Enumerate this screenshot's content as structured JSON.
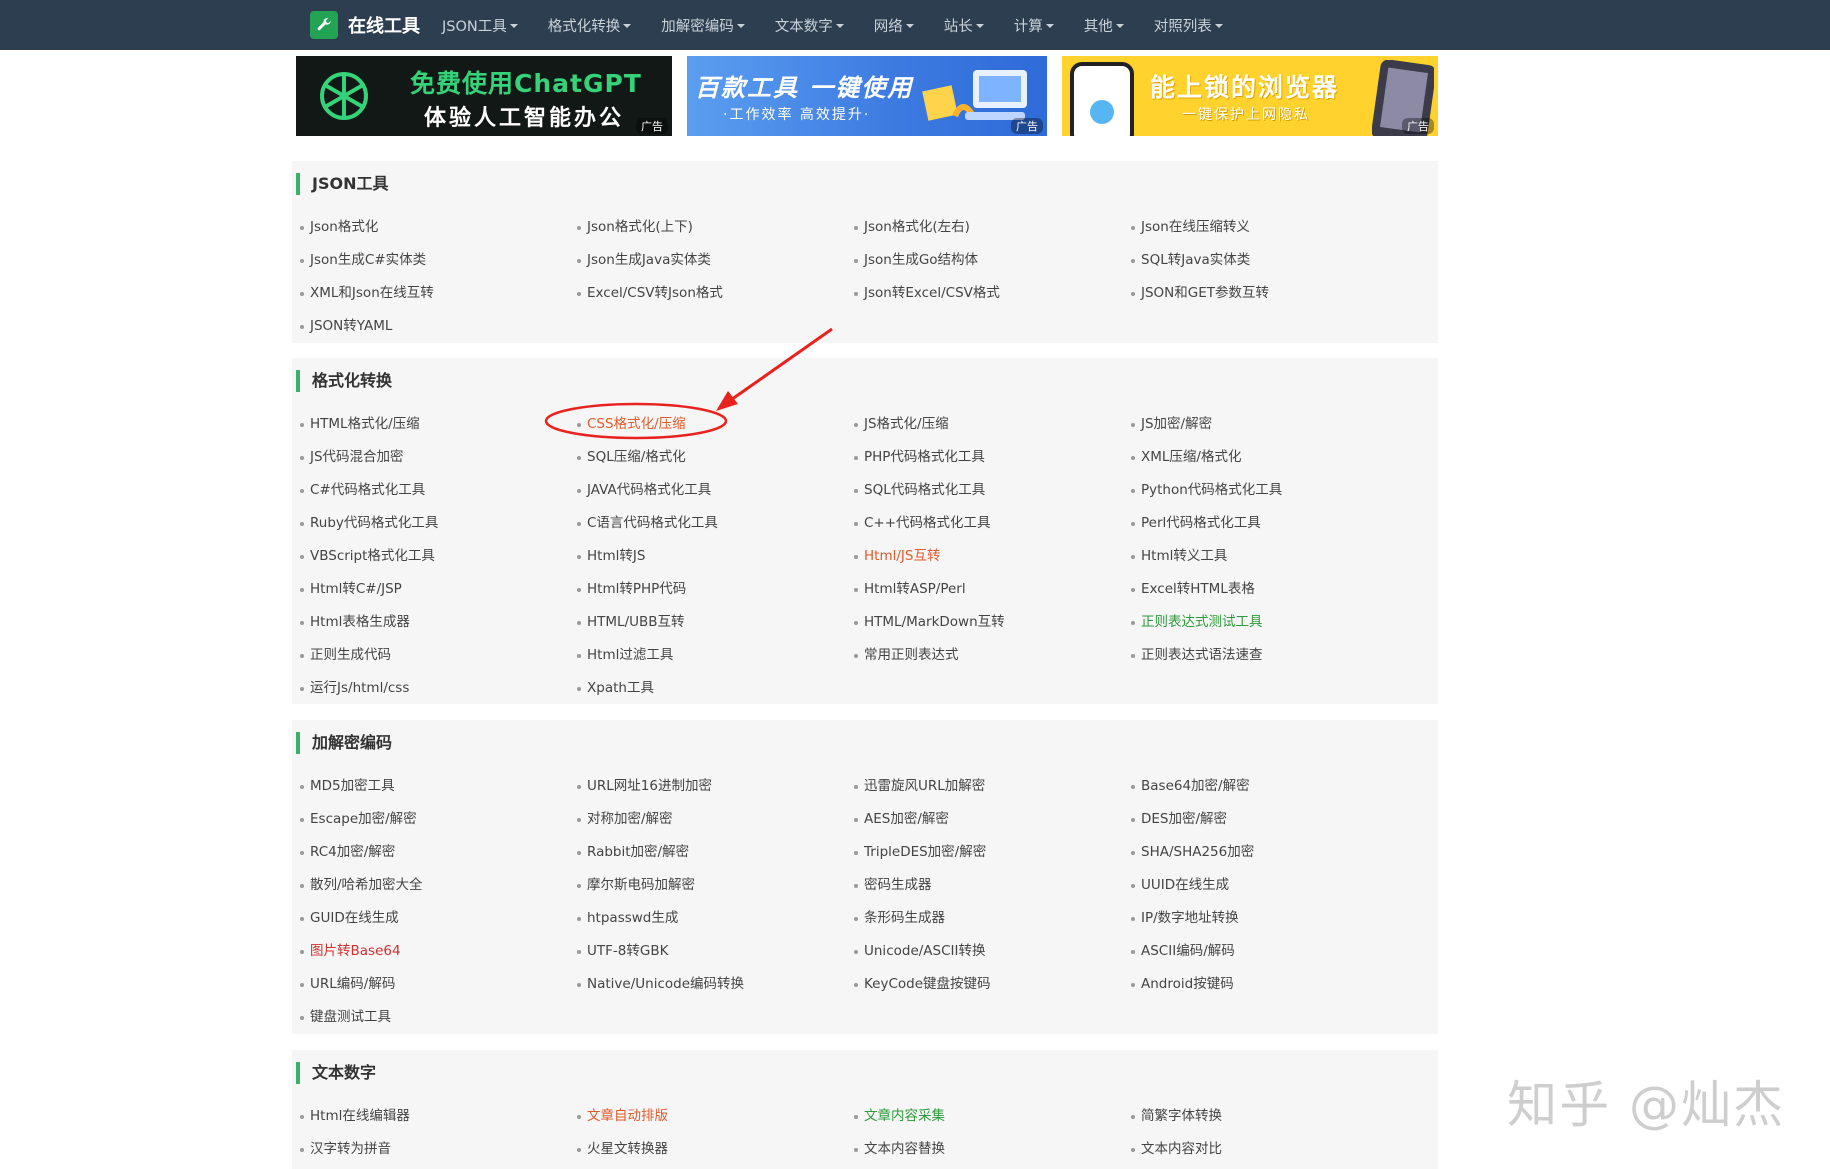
{
  "nav": {
    "brand": "在线工具",
    "items": [
      "JSON工具",
      "格式化转换",
      "加解密编码",
      "文本数字",
      "网络",
      "站长",
      "计算",
      "其他",
      "对照列表"
    ]
  },
  "banners": [
    {
      "line1": "免费使用ChatGPT",
      "line2": "体验人工智能办公",
      "tag": "广告"
    },
    {
      "line1": "百款工具 一键使用",
      "line2": "·工作效率 高效提升·",
      "tag": "广告"
    },
    {
      "line1": "能上锁的浏览器",
      "line2": "一键保护上网隐私",
      "tag": "广告"
    }
  ],
  "sections": [
    {
      "title": "JSON工具",
      "items": [
        {
          "label": "Json格式化"
        },
        {
          "label": "Json格式化(上下)"
        },
        {
          "label": "Json格式化(左右)"
        },
        {
          "label": "Json在线压缩转义"
        },
        {
          "label": "Json生成C#实体类"
        },
        {
          "label": "Json生成Java实体类"
        },
        {
          "label": "Json生成Go结构体"
        },
        {
          "label": "SQL转Java实体类"
        },
        {
          "label": "XML和Json在线互转"
        },
        {
          "label": "Excel/CSV转Json格式"
        },
        {
          "label": "Json转Excel/CSV格式"
        },
        {
          "label": "JSON和GET参数互转"
        },
        {
          "label": "JSON转YAML"
        }
      ]
    },
    {
      "title": "格式化转换",
      "items": [
        {
          "label": "HTML格式化/压缩"
        },
        {
          "label": "CSS格式化/压缩",
          "style": "red"
        },
        {
          "label": "JS格式化/压缩"
        },
        {
          "label": "JS加密/解密"
        },
        {
          "label": "JS代码混合加密"
        },
        {
          "label": "SQL压缩/格式化"
        },
        {
          "label": "PHP代码格式化工具"
        },
        {
          "label": "XML压缩/格式化"
        },
        {
          "label": "C#代码格式化工具"
        },
        {
          "label": "JAVA代码格式化工具"
        },
        {
          "label": "SQL代码格式化工具"
        },
        {
          "label": "Python代码格式化工具"
        },
        {
          "label": "Ruby代码格式化工具"
        },
        {
          "label": "C语言代码格式化工具"
        },
        {
          "label": "C++代码格式化工具"
        },
        {
          "label": "Perl代码格式化工具"
        },
        {
          "label": "VBScript格式化工具"
        },
        {
          "label": "Html转JS"
        },
        {
          "label": "Html/JS互转",
          "style": "red"
        },
        {
          "label": "Html转义工具"
        },
        {
          "label": "Html转C#/JSP"
        },
        {
          "label": "Html转PHP代码"
        },
        {
          "label": "Html转ASP/Perl"
        },
        {
          "label": "Excel转HTML表格"
        },
        {
          "label": "Html表格生成器"
        },
        {
          "label": "HTML/UBB互转"
        },
        {
          "label": "HTML/MarkDown互转"
        },
        {
          "label": "正则表达式测试工具",
          "style": "green"
        },
        {
          "label": "正则生成代码"
        },
        {
          "label": "Html过滤工具"
        },
        {
          "label": "常用正则表达式"
        },
        {
          "label": "正则表达式语法速查"
        },
        {
          "label": "运行Js/html/css"
        },
        {
          "label": "Xpath工具"
        }
      ]
    },
    {
      "title": "加解密编码",
      "items": [
        {
          "label": "MD5加密工具"
        },
        {
          "label": "URL网址16进制加密"
        },
        {
          "label": "迅雷旋风URL加解密"
        },
        {
          "label": "Base64加密/解密"
        },
        {
          "label": "Escape加密/解密"
        },
        {
          "label": "对称加密/解密"
        },
        {
          "label": "AES加密/解密"
        },
        {
          "label": "DES加密/解密"
        },
        {
          "label": "RC4加密/解密"
        },
        {
          "label": "Rabbit加密/解密"
        },
        {
          "label": "TripleDES加密/解密"
        },
        {
          "label": "SHA/SHA256加密"
        },
        {
          "label": "散列/哈希加密大全"
        },
        {
          "label": "摩尔斯电码加解密"
        },
        {
          "label": "密码生成器"
        },
        {
          "label": "UUID在线生成"
        },
        {
          "label": "GUID在线生成"
        },
        {
          "label": "htpasswd生成"
        },
        {
          "label": "条形码生成器"
        },
        {
          "label": "IP/数字地址转换"
        },
        {
          "label": "图片转Base64",
          "style": "deep-red"
        },
        {
          "label": "UTF-8转GBK"
        },
        {
          "label": "Unicode/ASCII转换"
        },
        {
          "label": "ASCII编码/解码"
        },
        {
          "label": "URL编码/解码"
        },
        {
          "label": "Native/Unicode编码转换"
        },
        {
          "label": "KeyCode键盘按键码"
        },
        {
          "label": "Android按键码"
        },
        {
          "label": "键盘测试工具"
        }
      ]
    },
    {
      "title": "文本数字",
      "items": [
        {
          "label": "Html在线编辑器"
        },
        {
          "label": "文章自动排版",
          "style": "red"
        },
        {
          "label": "文章内容采集",
          "style": "green"
        },
        {
          "label": "简繁字体转换"
        },
        {
          "label": "汉字转为拼音"
        },
        {
          "label": "火星文转换器"
        },
        {
          "label": "文本内容替换"
        },
        {
          "label": "文本内容对比"
        }
      ]
    }
  ],
  "watermark": "知乎 @灿杰",
  "colors": {
    "nav_bg": "#2c3e50",
    "accent_green": "#36b26a",
    "link_red": "#e05a2b",
    "annotation_red": "#e8231f"
  }
}
